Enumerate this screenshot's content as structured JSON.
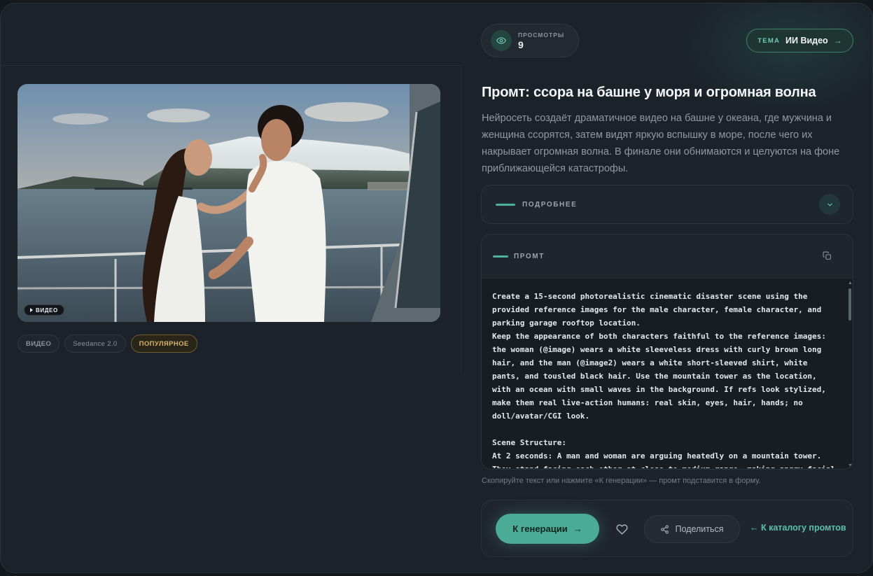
{
  "views": {
    "label": "ПРОСМОТРЫ",
    "count": "9",
    "icon": "eye-icon"
  },
  "topic": {
    "label": "ТЕМА",
    "value": "ИИ Видео",
    "arrow": "→"
  },
  "media": {
    "badge": "ВИДЕО",
    "alt": "Мужчина и женщина ссорятся на башне у моря"
  },
  "tags": [
    "ВИДЕО",
    "Seedance 2.0",
    "ПОПУЛЯРНОЕ"
  ],
  "title": "Промт: ссора на башне у моря и огромная волна",
  "description": "Нейросеть создаёт драматичное видео на башне у океана, где мужчина и женщина ссорятся, затем видят яркую вспышку в море, после чего их накрывает огромная волна. В финале они обнимаются и целуются на фоне приближающейся катастрофы.",
  "details": {
    "label": "ПОДРОБНЕЕ"
  },
  "prompt": {
    "label": "ПРОМТ",
    "text": "Create a 15-second photorealistic cinematic disaster scene using the provided reference images for the male character, female character, and parking garage rooftop location.\nKeep the appearance of both characters faithful to the reference images: the woman (@image) wears a white sleeveless dress with curly brown long hair, and the man (@image2) wears a white short-sleeved shirt, white pants, and tousled black hair. Use the mountain tower as the location, with an ocean with small waves in the background. If refs look stylized, make them real live-action humans: real skin, eyes, hair, hands; no doll/avatar/CGI look.\n\nScene Structure:\nAt 2 seconds: A man and woman are arguing heatedly on a mountain tower. They stand facing each other at close to medium range, making angry facial expressions, sharp hand gestures, tense eye contact, and emotionally"
  },
  "hint": "Скопируйте текст или нажмите «К генерации» — промт подставится в форму.",
  "actions": {
    "generate": "К генерации",
    "generate_arrow": "→",
    "share": "Поделиться",
    "catalog": "← К каталогу промтов"
  },
  "colors": {
    "accent": "#4cab95",
    "popular": "#d7b468",
    "background": "#1c222a"
  }
}
